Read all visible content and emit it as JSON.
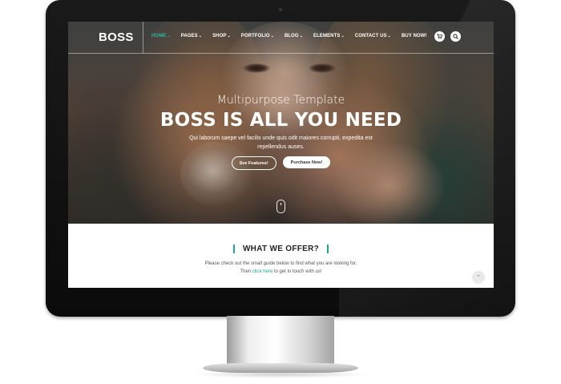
{
  "site": {
    "logo": "BOSS"
  },
  "nav": {
    "items": [
      {
        "label": "HOME",
        "active": true
      },
      {
        "label": "PAGES",
        "active": false
      },
      {
        "label": "SHOP",
        "active": false
      },
      {
        "label": "PORTFOLIO",
        "active": false
      },
      {
        "label": "BLOG",
        "active": false
      },
      {
        "label": "ELEMENTS",
        "active": false
      },
      {
        "label": "CONTACT US",
        "active": false
      },
      {
        "label": "BUY NOW!",
        "active": false
      }
    ],
    "icons": [
      "cart-icon",
      "search-icon"
    ]
  },
  "hero": {
    "subtitle": "Multipurpose Template",
    "title": "BOSS IS ALL YOU NEED",
    "description": "Qui laborum saepe vel facilis unde quis odit maiores corrupti, expedita est repellendus auses.",
    "buttons": {
      "features": "See Features!",
      "purchase": "Purchase Now!"
    }
  },
  "offer": {
    "title": "WHAT WE OFFER?",
    "line1": "Please check out the small guide below to find what you are looking for.",
    "line2_before": "Then ",
    "line2_link": "click here",
    "line2_after": " to get in touch with us!"
  },
  "colors": {
    "accent": "#1fa597",
    "nav_active": "#2bb3a6"
  }
}
